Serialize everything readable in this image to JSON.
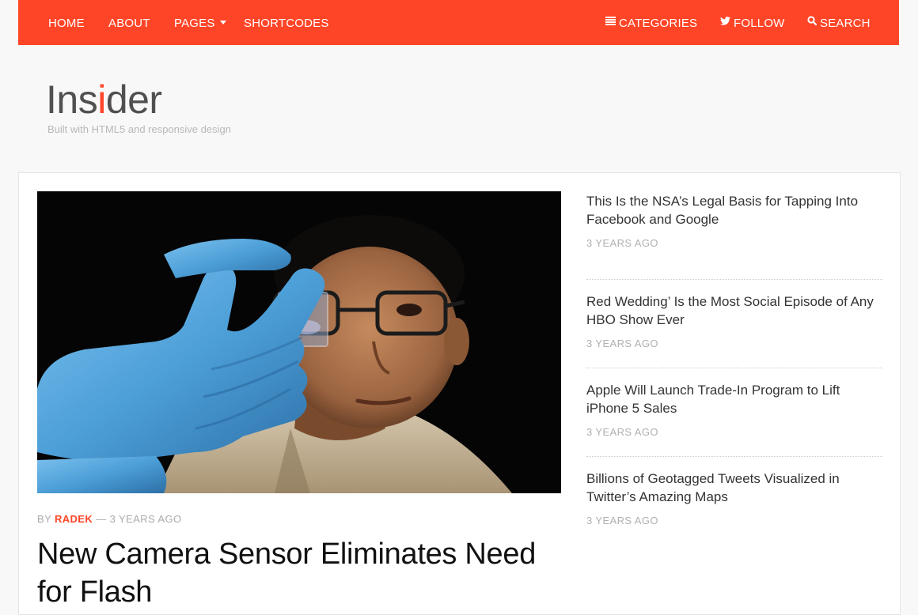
{
  "nav": {
    "home": "HOME",
    "about": "ABOUT",
    "pages": "PAGES",
    "shortcodes": "SHORTCODES",
    "categories": "CATEGORIES",
    "follow": "FOLLOW",
    "search": "SEARCH"
  },
  "brand": {
    "logo_before": "Ins",
    "logo_accent": "i",
    "logo_after": "der",
    "tagline": "Built with HTML5 and responsive design"
  },
  "feature": {
    "by_label": "BY",
    "author": "RADEK",
    "separator": "—",
    "time": "3 YEARS AGO",
    "title": "New Camera Sensor Eliminates Need for Flash"
  },
  "sidebar": {
    "items": [
      {
        "title": "This Is the NSA’s Legal Basis for Tapping Into Facebook and Google",
        "time": "3 YEARS AGO"
      },
      {
        "title": "Red Wedding’ Is the Most Social Episode of Any HBO Show Ever",
        "time": "3 YEARS AGO"
      },
      {
        "title": "Apple Will Launch Trade-In Program to Lift iPhone 5 Sales",
        "time": "3 YEARS AGO"
      },
      {
        "title": "Billions of Geotagged Tweets Visualized in Twitter’s Amazing Maps",
        "time": "3 YEARS AGO"
      }
    ]
  },
  "colors": {
    "accent": "#ff4527",
    "page_bg": "#f8f8f8",
    "glove": "#4d9fd8"
  }
}
